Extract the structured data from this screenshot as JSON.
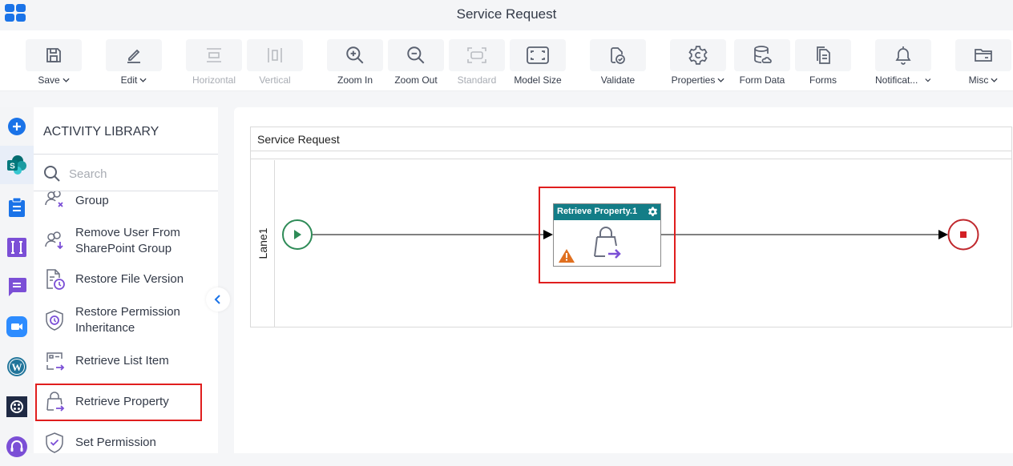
{
  "header": {
    "title": "Service Request"
  },
  "toolbar": {
    "buttons": [
      {
        "id": "save",
        "label": "Save",
        "has_dropdown": true,
        "enabled": true,
        "icon": "save-icon"
      },
      {
        "id": "edit",
        "label": "Edit",
        "has_dropdown": true,
        "enabled": true,
        "icon": "edit-icon"
      },
      {
        "id": "horizontal",
        "label": "Horizontal",
        "has_dropdown": false,
        "enabled": false,
        "icon": "horizontal-layout-icon"
      },
      {
        "id": "vertical",
        "label": "Vertical",
        "has_dropdown": false,
        "enabled": false,
        "icon": "vertical-layout-icon"
      },
      {
        "id": "zoom-in",
        "label": "Zoom In",
        "has_dropdown": false,
        "enabled": true,
        "icon": "zoom-in-icon"
      },
      {
        "id": "zoom-out",
        "label": "Zoom Out",
        "has_dropdown": false,
        "enabled": true,
        "icon": "zoom-out-icon"
      },
      {
        "id": "standard",
        "label": "Standard",
        "has_dropdown": false,
        "enabled": false,
        "icon": "standard-size-icon"
      },
      {
        "id": "model-size",
        "label": "Model Size",
        "has_dropdown": false,
        "enabled": true,
        "icon": "model-size-icon"
      },
      {
        "id": "validate",
        "label": "Validate",
        "has_dropdown": false,
        "enabled": true,
        "icon": "validate-icon"
      },
      {
        "id": "properties",
        "label": "Properties",
        "has_dropdown": true,
        "enabled": true,
        "icon": "gear-icon"
      },
      {
        "id": "form-data",
        "label": "Form Data",
        "has_dropdown": false,
        "enabled": true,
        "icon": "database-icon"
      },
      {
        "id": "forms",
        "label": "Forms",
        "has_dropdown": false,
        "enabled": true,
        "icon": "forms-icon"
      },
      {
        "id": "notifications",
        "label": "Notificat...",
        "has_dropdown": true,
        "enabled": true,
        "icon": "bell-icon"
      },
      {
        "id": "misc",
        "label": "Misc",
        "has_dropdown": true,
        "enabled": true,
        "icon": "folder-icon"
      }
    ]
  },
  "rail": {
    "items": [
      {
        "name": "add",
        "icon": "add-circle-icon",
        "color": "#1a73e8"
      },
      {
        "name": "sharepoint",
        "icon": "sharepoint-icon",
        "color": "#038387",
        "active": true
      },
      {
        "name": "clipboard",
        "icon": "clipboard-icon",
        "color": "#1a73e8"
      },
      {
        "name": "text-tool",
        "icon": "text-cursor-icon",
        "color": "#7b4fd6"
      },
      {
        "name": "chat",
        "icon": "chat-icon",
        "color": "#7b4fd6"
      },
      {
        "name": "zoom-meetings",
        "icon": "video-camera-icon",
        "color": "#2d8cff"
      },
      {
        "name": "wordpress",
        "icon": "wordpress-icon",
        "color": "#21759b"
      },
      {
        "name": "twilio",
        "icon": "twilio-icon",
        "color": "#1f2a44"
      },
      {
        "name": "support",
        "icon": "headset-icon",
        "color": "#7b4fd6"
      }
    ]
  },
  "library": {
    "title": "ACTIVITY LIBRARY",
    "search_placeholder": "Search",
    "search_value": "",
    "items": [
      {
        "label": "Remove SharePoint Group",
        "icon": "remove-group-icon",
        "partially_hidden": true
      },
      {
        "label": "Remove User From SharePoint Group",
        "icon": "remove-user-icon"
      },
      {
        "label": "Restore File Version",
        "icon": "restore-file-icon"
      },
      {
        "label": "Restore Permission Inheritance",
        "icon": "restore-permission-icon"
      },
      {
        "label": "Retrieve List Item",
        "icon": "retrieve-list-item-icon"
      },
      {
        "label": "Retrieve Property",
        "icon": "retrieve-property-icon",
        "highlighted": true
      },
      {
        "label": "Set Permission",
        "icon": "set-permission-icon"
      }
    ]
  },
  "canvas": {
    "pool_title": "Service Request",
    "lane_label": "Lane1",
    "task": {
      "title": "Retrieve Property.1",
      "has_warning": true,
      "highlighted": true
    },
    "start_event": "start",
    "end_event": "end"
  },
  "colors": {
    "accent": "#1a73e8",
    "task_header": "#137d87",
    "highlight": "#e01e1e",
    "start": "#2e8b57",
    "end": "#c0282d",
    "warning": "#e07020",
    "activity_purple": "#7b4fd6"
  }
}
